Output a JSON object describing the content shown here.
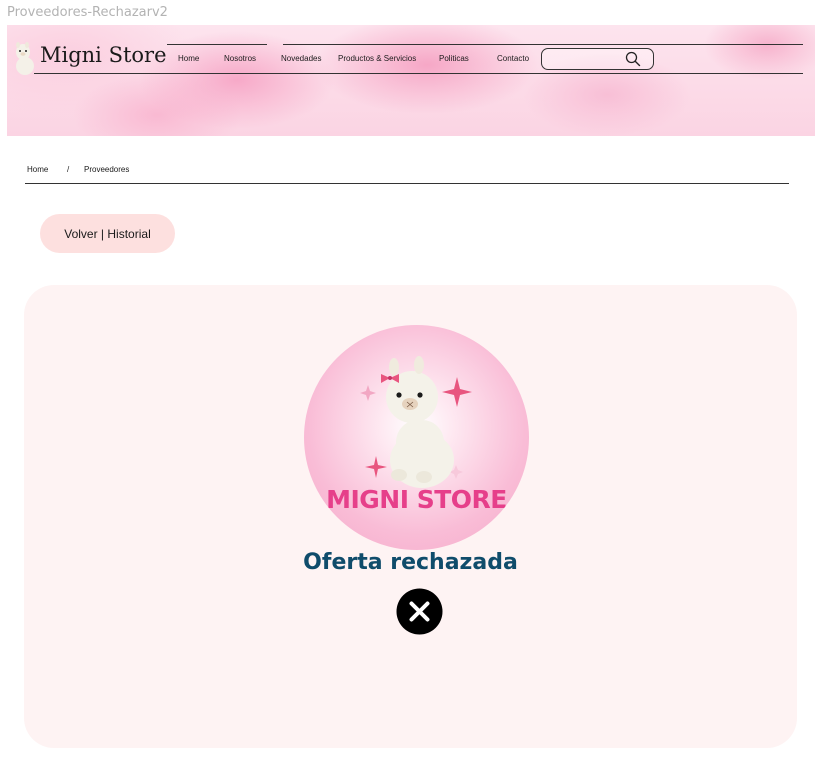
{
  "frame": {
    "title": "Proveedores-Rechazarv2"
  },
  "header": {
    "brand": "Migni Store",
    "nav": [
      "Home",
      "Nosotros",
      "Novedades",
      "Productos & Servicios",
      "Politicas",
      "Contacto"
    ],
    "search": {
      "value": "",
      "placeholder": ""
    }
  },
  "breadcrumb": {
    "home": "Home",
    "separator": "/",
    "current": "Proveedores"
  },
  "back_button": {
    "label": "Volver | Historial"
  },
  "result": {
    "logo_text": "MIGNI STORE",
    "title": "Oferta rechazada",
    "icon": "close-circle-icon"
  },
  "colors": {
    "header_pink": "#f7a9c8",
    "button_bg": "#fde0df",
    "card_bg": "#fef3f3",
    "title_color": "#0f4c6b",
    "logo_pink": "#e63f8a",
    "reject_icon": "#000000"
  }
}
